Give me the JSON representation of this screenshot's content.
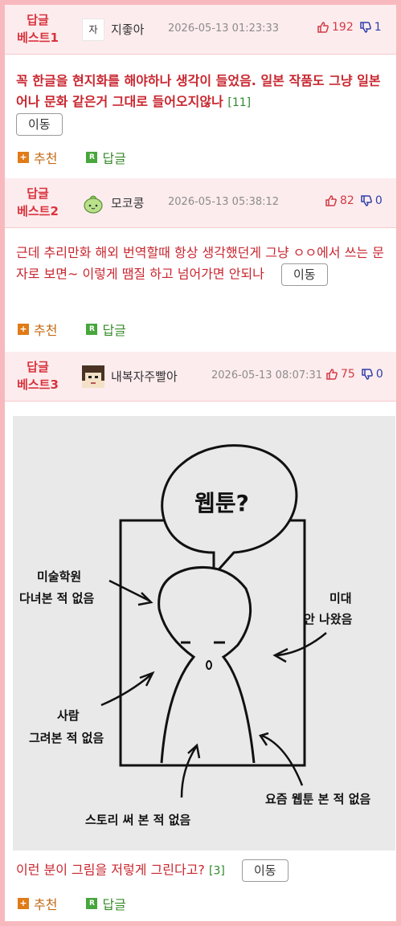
{
  "comments": [
    {
      "badge": [
        "답글",
        "베스트1"
      ],
      "avatar_text": "자",
      "nick": "지좋아",
      "date": "2026-05-13 01:23:33",
      "up": "192",
      "down": "1",
      "text": "꼭 한글을 현지화를 해야하나 생각이 들었음. 일본 작품도 그냥 일본어나 문화 같은거 그대로 들어오지않나",
      "count": "[11]",
      "move": "이동",
      "recommend": "추천",
      "reply": "답글"
    },
    {
      "badge": [
        "답글",
        "베스트2"
      ],
      "nick": "모코콩",
      "date": "2026-05-13 05:38:12",
      "up": "82",
      "down": "0",
      "text": "근데 추리만화 해외 번역할때 항상 생각했던게 그냥 ㅇㅇ에서 쓰는 문자로 보면~ 이렇게 땜질 하고 넘어가면 안되나",
      "move": "이동",
      "recommend": "추천",
      "reply": "답글"
    },
    {
      "badge": [
        "답글",
        "베스트3"
      ],
      "nick": "내복자주빨아",
      "date": "2026-05-13 08:07:31",
      "up": "75",
      "down": "0",
      "image": {
        "bubble": "웹툰?",
        "labels": {
          "art_school": [
            "미술학원",
            "다녀본 적 없음"
          ],
          "art_college": [
            "미대",
            "안 나왔음"
          ],
          "drew_people": [
            "사람",
            "그려본 적 없음"
          ],
          "story": "스토리 써 본 적 없음",
          "webtoon": "요즘 웹툰 본 적 없음"
        }
      },
      "text": "이런 분이 그림을 저렇게 그린다고?",
      "count": "[3]",
      "move": "이동",
      "recommend": "추천",
      "reply": "답글"
    }
  ]
}
